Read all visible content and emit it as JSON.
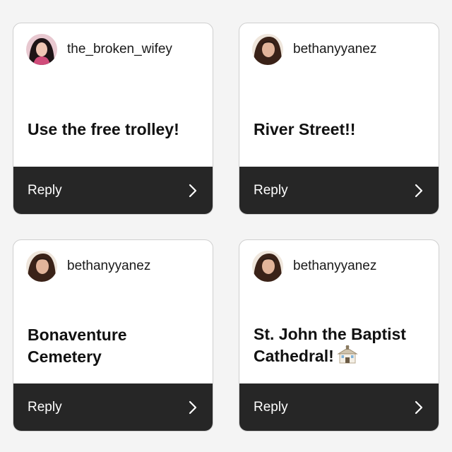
{
  "colors": {
    "page_background": "#f4f4f4",
    "card_background": "#ffffff",
    "reply_bar": "#262626",
    "reply_text": "#ffffff"
  },
  "cards": [
    {
      "username": "the_broken_wifey",
      "avatar_icon": "user-avatar-icon",
      "text": "Use the free trolley!",
      "reply_label": "Reply",
      "chevron_icon": "chevron-right-icon"
    },
    {
      "username": "bethanyyanez",
      "avatar_icon": "user-avatar-icon",
      "text": "River Street!!",
      "reply_label": "Reply",
      "chevron_icon": "chevron-right-icon"
    },
    {
      "username": "bethanyyanez",
      "avatar_icon": "user-avatar-icon",
      "text": "Bonaventure\nCemetery",
      "reply_label": "Reply",
      "chevron_icon": "chevron-right-icon"
    },
    {
      "username": "bethanyyanez",
      "avatar_icon": "user-avatar-icon",
      "text": "St. John the Baptist\nCathedral!",
      "emoji_icon": "church-icon",
      "reply_label": "Reply",
      "chevron_icon": "chevron-right-icon"
    }
  ]
}
